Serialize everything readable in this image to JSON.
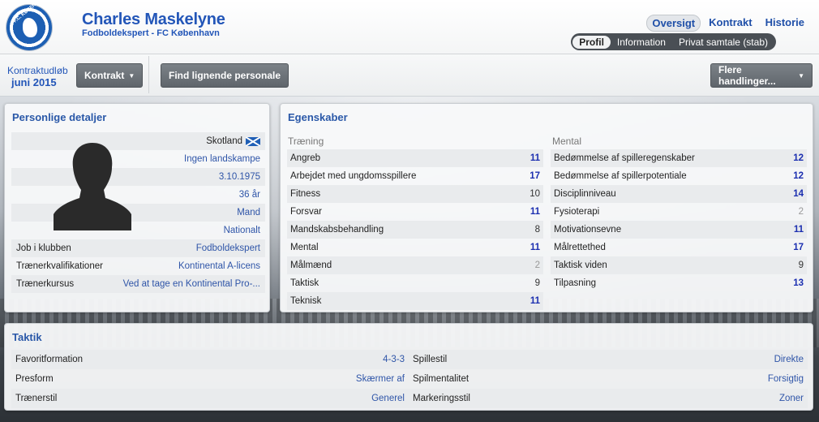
{
  "header": {
    "club_badge_text": "F.C. KØBENHAVN",
    "name": "Charles Maskelyne",
    "subtitle": "Fodboldekspert - FC København",
    "tabs": [
      "Oversigt",
      "Kontrakt",
      "Historie"
    ],
    "subtabs": [
      "Profil",
      "Information",
      "Privat samtale (stab)"
    ]
  },
  "actionbar": {
    "contract_label": "Kontraktudløb",
    "contract_value": "juni 2015",
    "contract_button": "Kontrakt",
    "find_button": "Find lignende personale",
    "more_button": "Flere handlinger..."
  },
  "personal": {
    "title": "Personlige detaljer",
    "nationality": "Skotland",
    "caps": "Ingen landskampe",
    "dob": "3.10.1975",
    "age": "36 år",
    "gender": "Mand",
    "status": "Nationalt",
    "rows": [
      {
        "label": "Job i klubben",
        "value": "Fodboldekspert"
      },
      {
        "label": "Trænerkvalifikationer",
        "value": "Kontinental A-licens"
      },
      {
        "label": "Trænerkursus",
        "value": "Ved at tage en Kontinental Pro-..."
      }
    ]
  },
  "attributes": {
    "title": "Egenskaber",
    "training_header": "Træning",
    "mental_header": "Mental",
    "training": [
      {
        "label": "Angreb",
        "value": "11",
        "tone": "blue"
      },
      {
        "label": "Arbejdet med ungdomsspillere",
        "value": "17",
        "tone": "blue"
      },
      {
        "label": "Fitness",
        "value": "10",
        "tone": "dark"
      },
      {
        "label": "Forsvar",
        "value": "11",
        "tone": "blue"
      },
      {
        "label": "Mandskabsbehandling",
        "value": "8",
        "tone": "dark"
      },
      {
        "label": "Mental",
        "value": "11",
        "tone": "blue"
      },
      {
        "label": "Målmænd",
        "value": "2",
        "tone": "grey"
      },
      {
        "label": "Taktisk",
        "value": "9",
        "tone": "dark"
      },
      {
        "label": "Teknisk",
        "value": "11",
        "tone": "blue"
      }
    ],
    "mental": [
      {
        "label": "Bedømmelse af spilleregenskaber",
        "value": "12",
        "tone": "blue"
      },
      {
        "label": "Bedømmelse af spillerpotentiale",
        "value": "12",
        "tone": "blue"
      },
      {
        "label": "Disciplinniveau",
        "value": "14",
        "tone": "blue"
      },
      {
        "label": "Fysioterapi",
        "value": "2",
        "tone": "grey"
      },
      {
        "label": "Motivationsevne",
        "value": "11",
        "tone": "blue"
      },
      {
        "label": "Målrettethed",
        "value": "17",
        "tone": "blue"
      },
      {
        "label": "Taktisk viden",
        "value": "9",
        "tone": "dark"
      },
      {
        "label": "Tilpasning",
        "value": "13",
        "tone": "blue"
      }
    ]
  },
  "tactics": {
    "title": "Taktik",
    "left": [
      {
        "label": "Favoritformation",
        "value": "4-3-3"
      },
      {
        "label": "Presform",
        "value": "Skærmer af"
      },
      {
        "label": "Trænerstil",
        "value": "Generel"
      }
    ],
    "right": [
      {
        "label": "Spillestil",
        "value": "Direkte"
      },
      {
        "label": "Spilmentalitet",
        "value": "Forsigtig"
      },
      {
        "label": "Markeringsstil",
        "value": "Zoner"
      }
    ]
  },
  "colors": {
    "accent": "#2356b8",
    "value_high": "#1c2fb0",
    "value_grey": "#999999"
  }
}
